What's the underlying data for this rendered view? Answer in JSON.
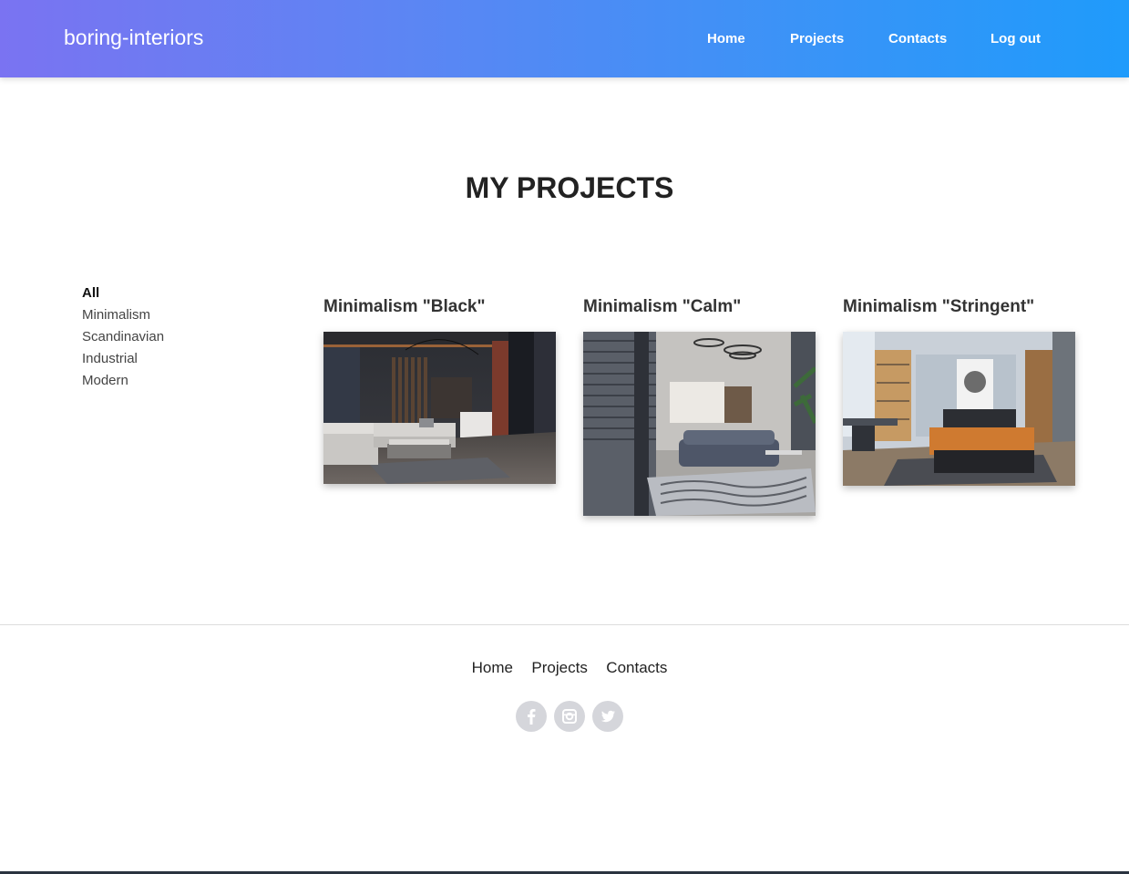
{
  "navbar": {
    "brand": "boring-interiors",
    "links": [
      "Home",
      "Projects",
      "Contacts",
      "Log out"
    ]
  },
  "main": {
    "title": "MY PROJECTS",
    "filters": [
      {
        "label": "All",
        "active": true
      },
      {
        "label": "Minimalism",
        "active": false
      },
      {
        "label": "Scandinavian",
        "active": false
      },
      {
        "label": "Industrial",
        "active": false
      },
      {
        "label": "Modern",
        "active": false
      }
    ],
    "projects": [
      {
        "title": "Minimalism \"Black\"",
        "image": "dark living room interior"
      },
      {
        "title": "Minimalism \"Calm\"",
        "image": "grey living room with kitchen"
      },
      {
        "title": "Minimalism \"Stringent\"",
        "image": "bedroom with orange bedspread"
      }
    ]
  },
  "footer": {
    "links": [
      "Home",
      "Projects",
      "Contacts"
    ],
    "social": [
      "facebook-icon",
      "instagram-icon",
      "twitter-icon"
    ]
  }
}
